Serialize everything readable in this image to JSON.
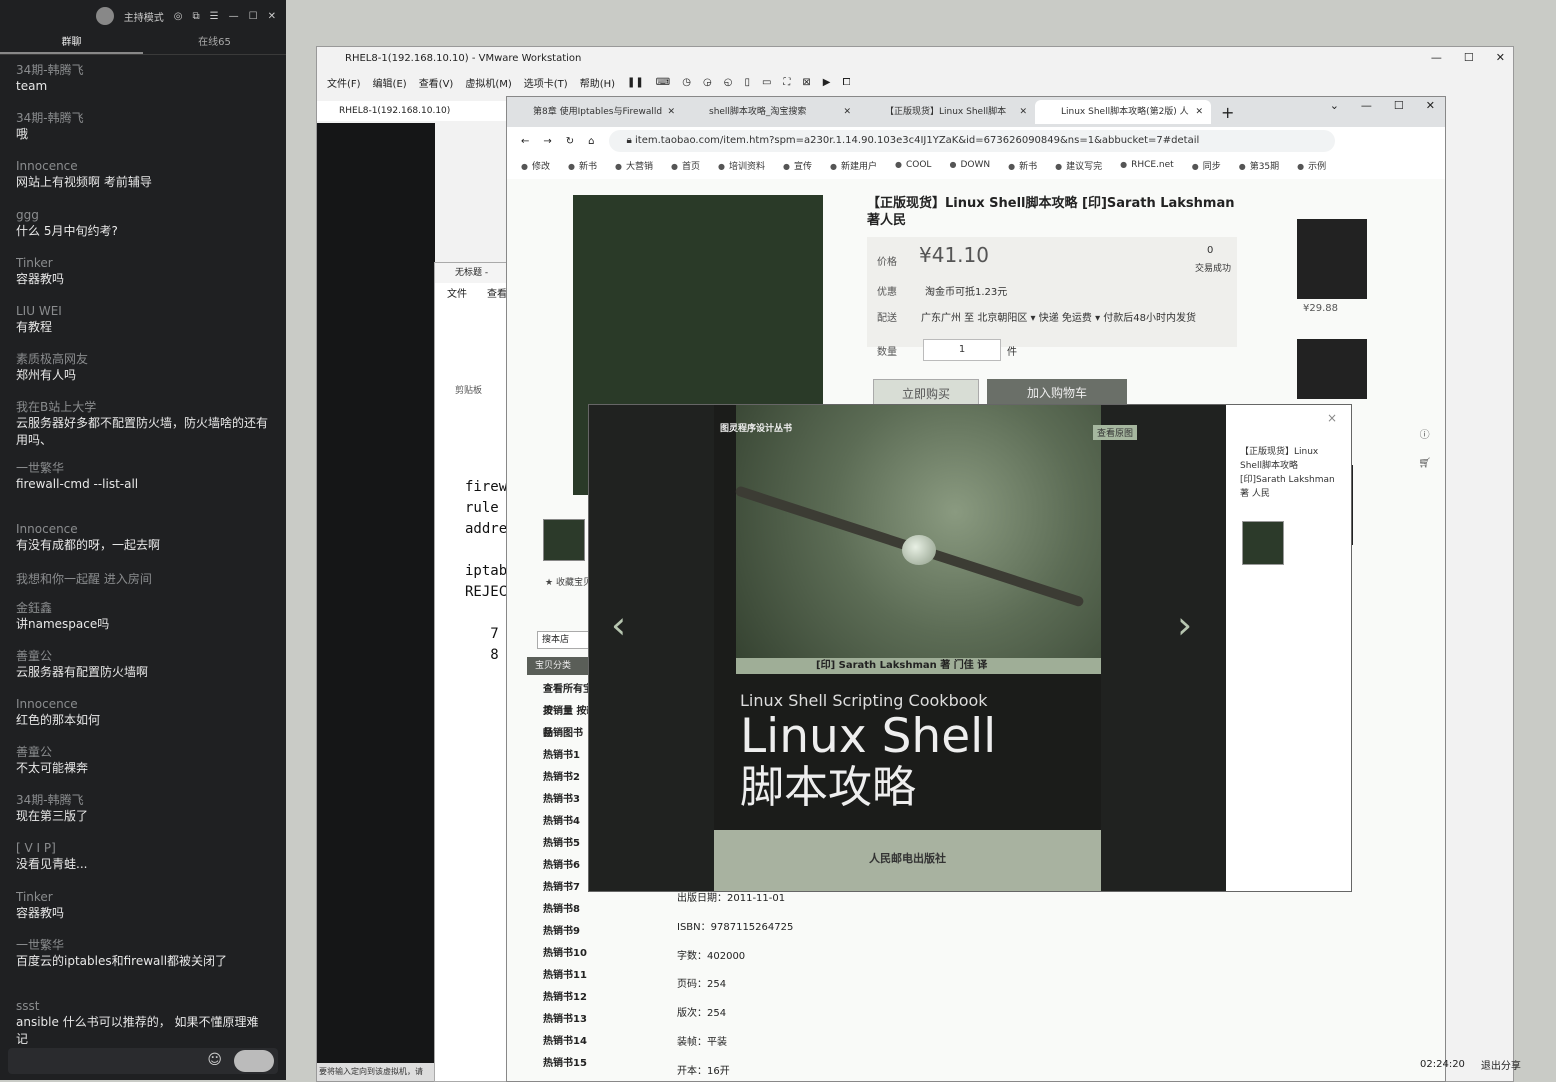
{
  "chat": {
    "host_label": "主持模式",
    "tabs": [
      "群聊",
      "在线65"
    ],
    "messages": [
      {
        "who": "34期-韩腾飞",
        "text": "team"
      },
      {
        "who": "34期-韩腾飞",
        "text": "哦"
      },
      {
        "who": "Innocence",
        "text": "网站上有视频啊 考前辅导"
      },
      {
        "who": "ggg",
        "text": "什么 5月中旬约考?"
      },
      {
        "who": "Tinker",
        "text": "容器教吗"
      },
      {
        "who": "LIU WEI",
        "text": "有教程"
      },
      {
        "who": "素质极高网友",
        "text": "郑州有人吗"
      },
      {
        "who": "我在B站上大学",
        "text": "云服务器好多都不配置防火墙，防火墙啥的还有用吗、"
      },
      {
        "who": "一世繁华",
        "text": "firewall-cmd --list-all"
      },
      {
        "who": "Innocence",
        "text": "有没有成都的呀，一起去啊"
      },
      {
        "who": "",
        "text": "我想和你一起醒 进入房间"
      },
      {
        "who": "金鈺鑫",
        "text": "讲namespace吗"
      },
      {
        "who": "善童公",
        "text": "云服务器有配置防火墙啊"
      },
      {
        "who": "Innocence",
        "text": "红色的那本如何"
      },
      {
        "who": "善童公",
        "text": "不太可能裸奔"
      },
      {
        "who": "34期-韩腾飞",
        "text": "现在第三版了"
      },
      {
        "who": "[ V I P]",
        "text": "没看见青蛙..."
      },
      {
        "who": "Tinker",
        "text": "容器教吗"
      },
      {
        "who": "一世繁华",
        "text": "百度云的iptables和firewall都被关闭了"
      },
      {
        "who": "ssst",
        "text": "ansible 什么书可以推荐的， 如果不懂原理难记"
      }
    ]
  },
  "vmware": {
    "title": "RHEL8-1(192.168.10.10) - VMware Workstation",
    "menu": [
      "文件(F)",
      "编辑(E)",
      "查看(V)",
      "虚拟机(M)",
      "选项卡(T)",
      "帮助(H)"
    ],
    "vm_tab": "RHEL8-1(192.168.10.10)",
    "status": "要将输入定向到该虚拟机，请"
  },
  "notepad": {
    "title": "无标题 -",
    "menu": [
      "文件",
      "查看"
    ],
    "clipboard_label": "剪贴板",
    "code_lines": [
      "firew",
      "rule",
      "addre",
      "",
      "iptab",
      "REJEC",
      "",
      "   7",
      "   8"
    ]
  },
  "browser": {
    "tabs": [
      "第8章 使用Iptables与Firewalld",
      "shell脚本攻略_淘宝搜索",
      "【正版现货】Linux Shell脚本",
      "Linux Shell脚本攻略(第2版) 人"
    ],
    "url": "item.taobao.com/item.htm?spm=a230r.1.14.90.103e3c4IJ1YZaK&id=673626090849&ns=1&abbucket=7#detail",
    "bookmarks": [
      "修改",
      "新书",
      "大营销",
      "首页",
      "培训资料",
      "宣传",
      "新建用户",
      "COOL",
      "DOWN",
      "新书",
      "建议写完",
      "RHCE.net",
      "同步",
      "第35期",
      "示例"
    ]
  },
  "product": {
    "title": "【正版现货】Linux Shell脚本攻略 [印]Sarath Lakshman 著人民",
    "price_label": "价格",
    "price": "¥41.10",
    "sales_count": "0",
    "sales_label": "交易成功",
    "promo_label": "优惠",
    "promo_text": "淘金币可抵1.23元",
    "ship_label": "配送",
    "ship_text": "广东广州 至 北京朝阳区 ▾  快递 免运费 ▾  付款后48小时内发货",
    "qty_label": "数量",
    "qty": "1",
    "qty_unit": "件",
    "buy_now": "立即购买",
    "add_cart": "加入购物车",
    "side_price": "¥29.88",
    "store_search": "搜本店",
    "fav_label": "收藏宝贝",
    "categories_header": "宝贝分类",
    "categories": [
      "查看所有宝贝",
      "按销量 按新品",
      "畅销图书",
      "热销书1",
      "热销书2",
      "热销书3",
      "热销书4",
      "热销书5",
      "热销书6",
      "热销书7",
      "热销书8",
      "热销书9",
      "热销书10",
      "热销书11",
      "热销书12",
      "热销书13",
      "热销书14",
      "热销书15"
    ],
    "details": [
      "出版日期：2011-11-01",
      "ISBN：9787115264725",
      "字数：402000",
      "页码：254",
      "版次：254",
      "装帧：平装",
      "开本：16开"
    ]
  },
  "lightbox": {
    "series": "图灵程序设计丛书",
    "author": "[印] Sarath Lakshman  著        门佳  译",
    "subtitle": "Linux Shell Scripting Cookbook",
    "main_title": "Linux Shell",
    "cn_title": "脚本攻略",
    "publisher": "人民邮电出版社",
    "side_title": "【正版现货】Linux Shell脚本攻略 [印]Sarath Lakshman 著 人民",
    "prev": "‹",
    "next": "›",
    "tag": "查看原图",
    "close": "×"
  },
  "clock": {
    "time": "02:24:20",
    "exit_share": "退出分享"
  }
}
